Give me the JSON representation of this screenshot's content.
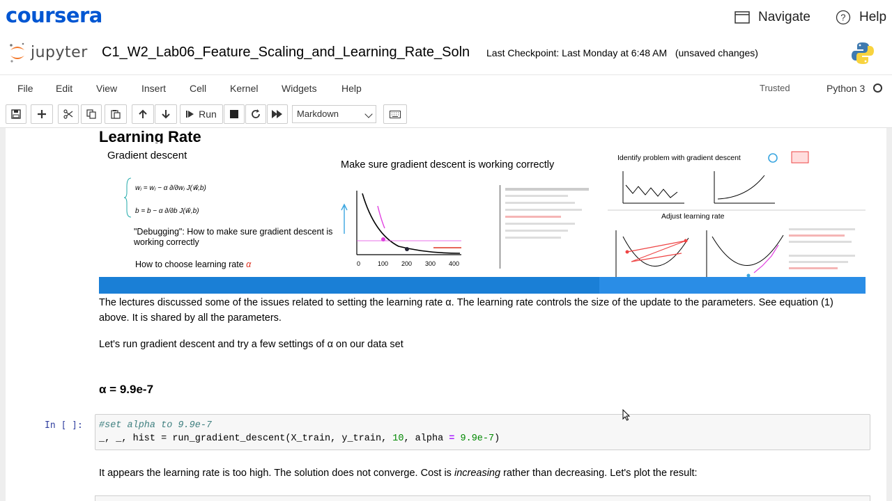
{
  "coursera": {
    "logo": "coursera",
    "navigate": "Navigate",
    "help": "Help"
  },
  "jupyter": {
    "logo_text": "jupyter",
    "notebook_name": "C1_W2_Lab06_Feature_Scaling_and_Learning_Rate_Soln",
    "checkpoint": "Last Checkpoint: Last Monday at 6:48 AM",
    "unsaved": "(unsaved changes)"
  },
  "menubar": {
    "items": [
      "File",
      "Edit",
      "View",
      "Insert",
      "Cell",
      "Kernel",
      "Widgets",
      "Help"
    ],
    "trusted": "Trusted",
    "kernel": "Python 3"
  },
  "toolbar": {
    "run_label": "Run",
    "cell_type": "Markdown"
  },
  "notebook": {
    "heading": "Learning Rate",
    "slides": {
      "left_title": "Gradient descent",
      "update_w": "wⱼ = wⱼ − α ∂/∂wⱼ J(w⃗,b)",
      "update_b": "b = b − α ∂/∂b J(w⃗,b)",
      "debugging": "\"Debugging\": How to make sure gradient descent is working correctly",
      "choose": "How to choose learning rate",
      "alpha": "α",
      "mid_title": "Make sure gradient descent is working correctly",
      "right_title": "Identify problem with gradient descent",
      "adjust_title": "Adjust learning rate"
    },
    "para1": "The lectures discussed some of the issues related to setting the learning rate α. The learning rate controls the size of the update to the parameters. See equation (1) above. It is shared by all the parameters.",
    "para2": "Let's run gradient descent and try a few settings of α on our data set",
    "subheading": "α = 9.9e-7",
    "prompt": "In [ ]:",
    "code_line1": "#set alpha to 9.9e-7",
    "code_line2_a": "_, _, hist = run_gradient_descent(X_train, y_train, ",
    "code_line2_num1": "10",
    "code_line2_b": ", alpha ",
    "code_line2_eq": "=",
    "code_line2_num2": " 9.9e-7",
    "code_line2_c": ")",
    "para3_a": "It appears the learning rate is too high. The solution does not converge. Cost is ",
    "para3_em": "increasing",
    "para3_b": " rather than decreasing. Let's plot the result:"
  },
  "colors": {
    "coursera_blue": "#0056d2",
    "jupyter_orange": "#f37626",
    "slide_bar": "#1a7fd6"
  }
}
